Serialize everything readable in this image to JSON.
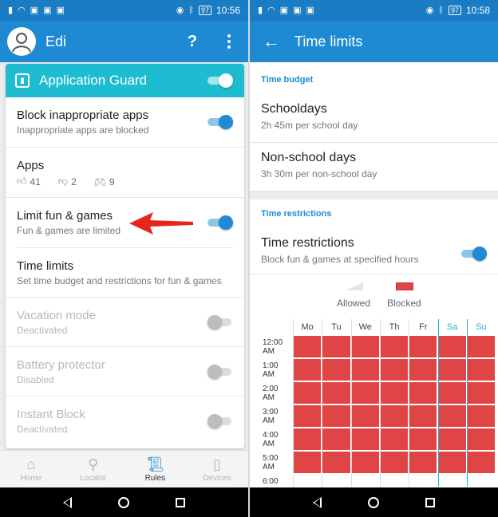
{
  "status_left": {
    "time": "10:56",
    "battery": "97"
  },
  "status_right": {
    "time": "10:58",
    "battery": "97"
  },
  "left": {
    "appbar": {
      "title": "Edi",
      "help": "?"
    },
    "card": {
      "title": "Application Guard",
      "items": [
        {
          "title": "Block inappropriate apps",
          "subtitle": "Inappropriate apps are blocked",
          "toggle": "on"
        },
        {
          "title": "Apps",
          "stats": {
            "allowed": "41",
            "disliked": "2",
            "games": "9"
          }
        },
        {
          "title": "Limit fun & games",
          "subtitle": "Fun & games are limited",
          "toggle": "on"
        },
        {
          "title": "Time limits",
          "subtitle": "Set time budget and restrictions for fun & games"
        },
        {
          "title": "Vacation mode",
          "subtitle": "Deactivated",
          "toggle": "off"
        },
        {
          "title": "Battery protector",
          "subtitle": "Disabled",
          "toggle": "off"
        },
        {
          "title": "Instant Block",
          "subtitle": "Deactivated",
          "toggle": "off"
        }
      ]
    },
    "bottom_nav": [
      {
        "label": "Home",
        "icon": "home-icon"
      },
      {
        "label": "Locator",
        "icon": "pin-icon"
      },
      {
        "label": "Rules",
        "icon": "scroll-icon",
        "active": true
      },
      {
        "label": "Devices",
        "icon": "devices-icon"
      }
    ]
  },
  "right": {
    "appbar": {
      "title": "Time limits"
    },
    "budget": {
      "label": "Time budget",
      "items": [
        {
          "title": "Schooldays",
          "subtitle": "2h 45m per school day"
        },
        {
          "title": "Non-school days",
          "subtitle": "3h 30m per non-school day"
        }
      ]
    },
    "restrictions": {
      "label": "Time restrictions",
      "title": "Time restrictions",
      "subtitle": "Block fun & games at specified hours",
      "toggle": "on",
      "legend": {
        "allowed": "Allowed",
        "blocked": "Blocked"
      },
      "days": [
        "Mo",
        "Tu",
        "We",
        "Th",
        "Fr",
        "Sa",
        "Su"
      ],
      "weekend_days": [
        "Sa",
        "Su"
      ],
      "times": [
        {
          "t": "12:00",
          "p": "AM"
        },
        {
          "t": "1:00",
          "p": "AM"
        },
        {
          "t": "2:00",
          "p": "AM"
        },
        {
          "t": "3:00",
          "p": "AM"
        },
        {
          "t": "4:00",
          "p": "AM"
        },
        {
          "t": "5:00",
          "p": "AM"
        },
        {
          "t": "6:00",
          "p": ""
        }
      ],
      "blocked_hours": [
        0,
        1,
        2,
        3,
        4,
        5
      ],
      "blocked_color": "#e04444"
    }
  },
  "colors": {
    "appbar": "#1e8ad3",
    "card_header": "#1ebcd0",
    "arrow": "#e8251c"
  }
}
